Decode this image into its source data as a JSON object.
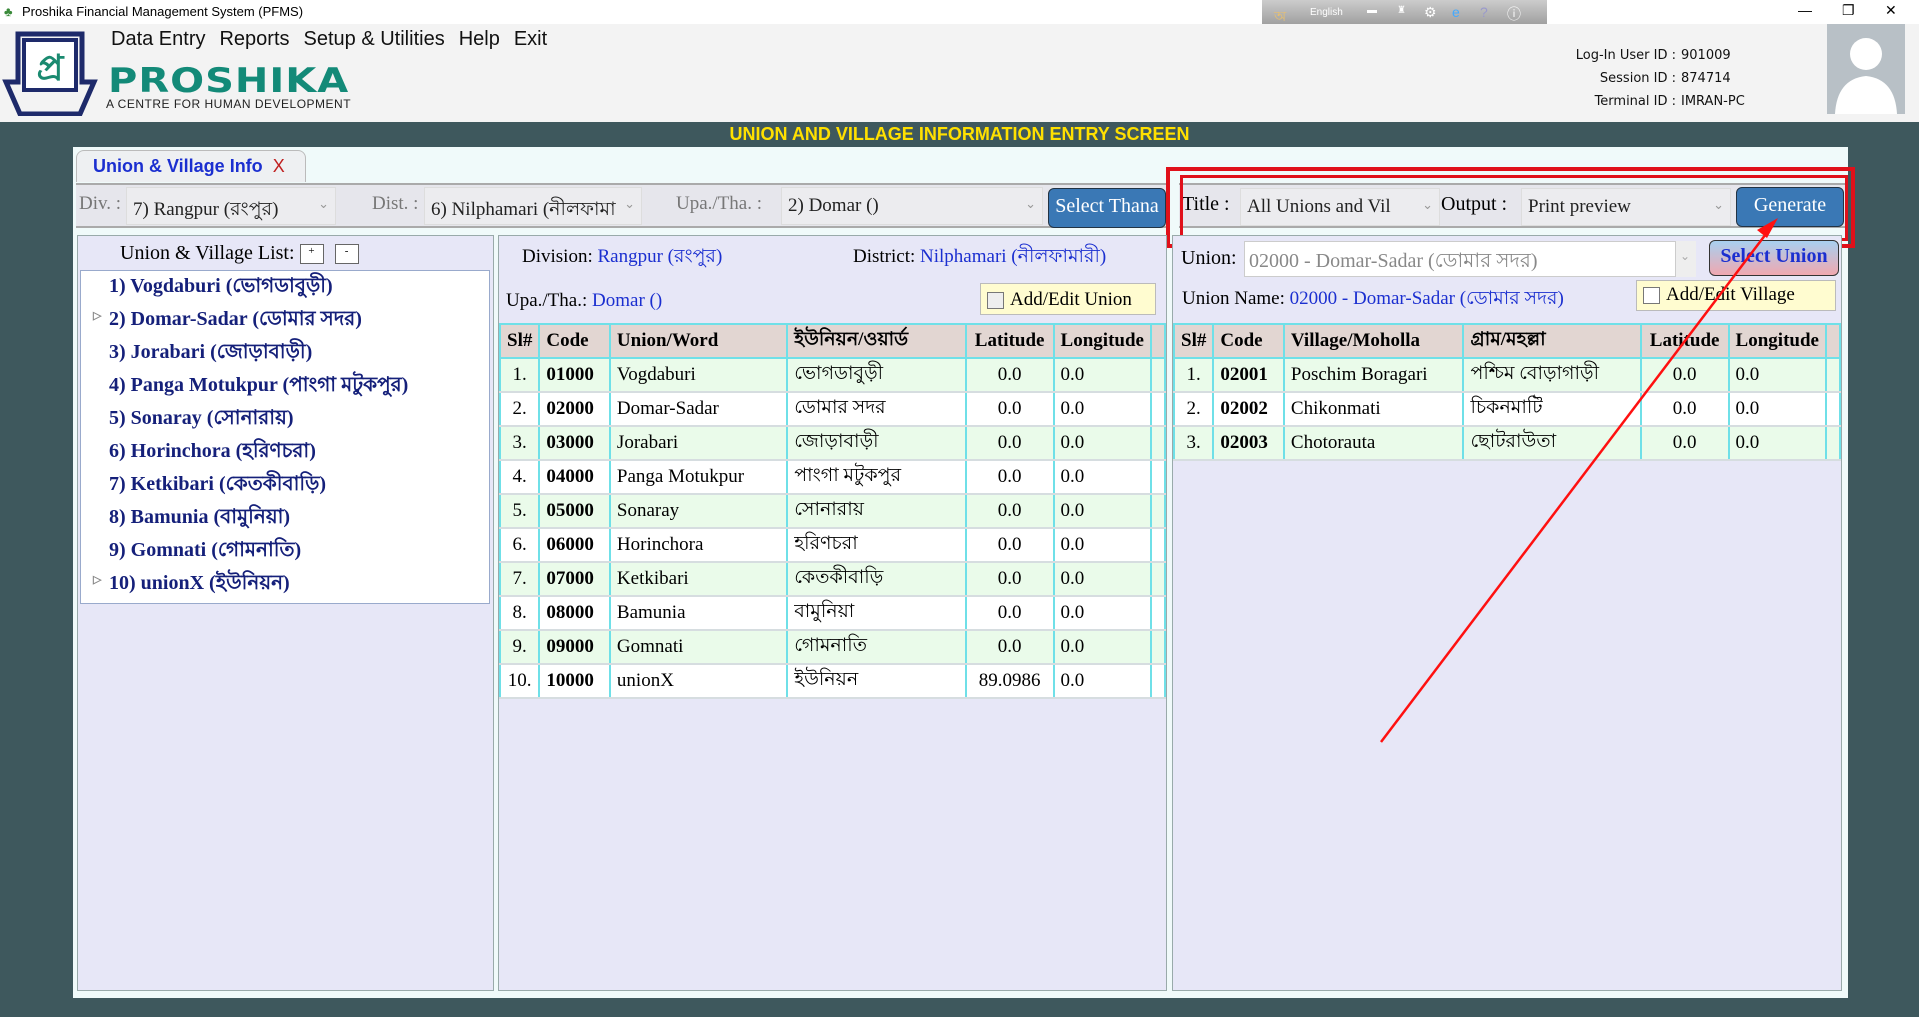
{
  "window": {
    "title": "Proshika Financial Management System (PFMS)",
    "min": "—",
    "max": "❐",
    "close": "✕"
  },
  "menu": [
    "Data Entry",
    "Reports",
    "Setup & Utilities",
    "Help",
    "Exit"
  ],
  "brand": {
    "name": "PROSHIKA",
    "tagline": "A CENTRE FOR HUMAN DEVELOPMENT"
  },
  "langbar": {
    "language": "English"
  },
  "session": {
    "user_label": "Log-In User ID :",
    "user": "901009",
    "session_label": "Session ID :",
    "session": "874714",
    "terminal_label": "Terminal ID :",
    "terminal": "IMRAN-PC"
  },
  "banner": "UNION AND VILLAGE INFORMATION ENTRY SCREEN",
  "tab": {
    "label": "Union & Village Info",
    "close": "X"
  },
  "filters": {
    "div_label": "Div. :",
    "div": "7) Rangpur (রংপুর)",
    "dist_label": "Dist. :",
    "dist": "6) Nilphamari (নীলফামা",
    "upa_label": "Upa./Tha. :",
    "upa": "2) Domar ()",
    "select_thana": "Select Thana"
  },
  "report": {
    "title_label": "Title :",
    "title": "All Unions and Vil",
    "output_label": "Output :",
    "output": "Print preview",
    "generate": "Generate"
  },
  "tree": {
    "label": "Union & Village List:",
    "expand": "+",
    "collapse": "-",
    "items": [
      "1) Vogdaburi (ভোগডাবুড়ী)",
      "2) Domar-Sadar (ডোমার সদর)",
      "3) Jorabari (জোড়াবাড়ী)",
      "4) Panga Motukpur (পাংগা মটুকপুর)",
      "5) Sonaray (সোনারায়)",
      "6) Horinchora (হরিণচরা)",
      "7) Ketkibari (কেতকীবাড়ি)",
      "8) Bamunia (বামুনিয়া)",
      "9) Gomnati (গোমনাতি)",
      "10) unionX (ইউনিয়ন)"
    ]
  },
  "union_panel": {
    "division_label": "Division:",
    "division": "Rangpur (রংপুর)",
    "district_label": "District:",
    "district": "Nilphamari (নীলফামারী)",
    "upa_label": "Upa./Tha.:",
    "upa": "Domar ()",
    "add_edit": "Add/Edit Union",
    "columns": [
      "Sl#",
      "Code",
      "Union/Word",
      "ইউনিয়ন/ওয়ার্ড",
      "Latitude",
      "Longitude"
    ],
    "rows": [
      [
        "1.",
        "01000",
        "Vogdaburi",
        "ভোগডাবুড়ী",
        "0.0",
        "0.0"
      ],
      [
        "2.",
        "02000",
        "Domar-Sadar",
        "ডোমার সদর",
        "0.0",
        "0.0"
      ],
      [
        "3.",
        "03000",
        "Jorabari",
        "জোড়াবাড়ী",
        "0.0",
        "0.0"
      ],
      [
        "4.",
        "04000",
        "Panga Motukpur",
        "পাংগা মটুকপুর",
        "0.0",
        "0.0"
      ],
      [
        "5.",
        "05000",
        "Sonaray",
        "সোনারায়",
        "0.0",
        "0.0"
      ],
      [
        "6.",
        "06000",
        "Horinchora",
        "হরিণচরা",
        "0.0",
        "0.0"
      ],
      [
        "7.",
        "07000",
        "Ketkibari",
        "কেতকীবাড়ি",
        "0.0",
        "0.0"
      ],
      [
        "8.",
        "08000",
        "Bamunia",
        "বামুনিয়া",
        "0.0",
        "0.0"
      ],
      [
        "9.",
        "09000",
        "Gomnati",
        "গোমনাতি",
        "0.0",
        "0.0"
      ],
      [
        "10.",
        "10000",
        "unionX",
        "ইউনিয়ন",
        "89.0986",
        "0.0"
      ]
    ]
  },
  "village_panel": {
    "union_label": "Union:",
    "union": "02000 - Domar-Sadar (ডোমার সদর)",
    "select_union": "Select Union",
    "union_name_label": "Union Name:",
    "union_name": "02000 - Domar-Sadar (ডোমার সদর)",
    "add_edit": "Add/Edit Village",
    "columns": [
      "Sl#",
      "Code",
      "Village/Moholla",
      "গ্রাম/মহল্লা",
      "Latitude",
      "Longitude"
    ],
    "rows": [
      [
        "1.",
        "02001",
        "Poschim Boragari",
        "পশ্চিম বোড়াগাড়ী",
        "0.0",
        "0.0"
      ],
      [
        "2.",
        "02002",
        "Chikonmati",
        "চিকনমাটি",
        "0.0",
        "0.0"
      ],
      [
        "3.",
        "02003",
        "Chotorauta",
        "ছোটরাউতা",
        "0.0",
        "0.0"
      ]
    ]
  },
  "colors": {
    "highlight": "#e0101a",
    "accent": "#1b2fd0",
    "banner": "#ffe000",
    "button": "#3a78b5"
  }
}
